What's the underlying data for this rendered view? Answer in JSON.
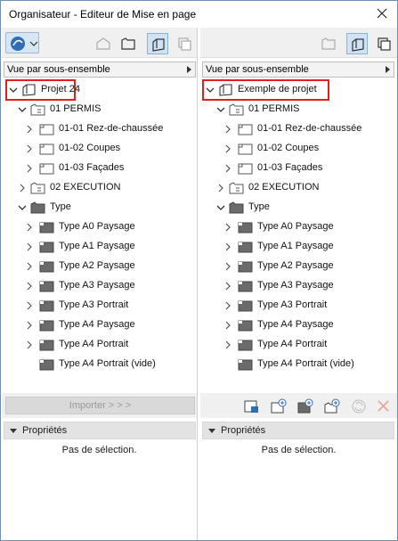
{
  "window": {
    "title": "Organisateur - Editeur de Mise en page"
  },
  "left": {
    "view_select": "Vue par sous-ensemble",
    "root": "Projet 24",
    "items": [
      {
        "label": "01 PERMIS"
      },
      {
        "label": "01-01 Rez-de-chaussée"
      },
      {
        "label": "01-02 Coupes"
      },
      {
        "label": "01-03 Façades"
      },
      {
        "label": "02 EXECUTION"
      },
      {
        "label": "Type"
      },
      {
        "label": "Type A0 Paysage"
      },
      {
        "label": "Type A1 Paysage"
      },
      {
        "label": "Type A2 Paysage"
      },
      {
        "label": "Type A3 Paysage"
      },
      {
        "label": "Type A3 Portrait"
      },
      {
        "label": "Type A4 Paysage"
      },
      {
        "label": "Type A4 Portrait"
      },
      {
        "label": "Type A4 Portrait (vide)"
      }
    ],
    "import_label": "Importer > > >",
    "props_title": "Propriétés",
    "props_text": "Pas de sélection."
  },
  "right": {
    "view_select": "Vue par sous-ensemble",
    "root": "Exemple de projet",
    "items": [
      {
        "label": "01 PERMIS"
      },
      {
        "label": "01-01 Rez-de-chaussée"
      },
      {
        "label": "01-02 Coupes"
      },
      {
        "label": "01-03 Façades"
      },
      {
        "label": "02 EXECUTION"
      },
      {
        "label": "Type"
      },
      {
        "label": "Type A0 Paysage"
      },
      {
        "label": "Type A1 Paysage"
      },
      {
        "label": "Type A2 Paysage"
      },
      {
        "label": "Type A3 Paysage"
      },
      {
        "label": "Type A3 Portrait"
      },
      {
        "label": "Type A4 Paysage"
      },
      {
        "label": "Type A4 Portrait"
      },
      {
        "label": "Type A4 Portrait (vide)"
      }
    ],
    "props_title": "Propriétés",
    "props_text": "Pas de sélection."
  },
  "colors": {
    "highlight_border": "#e0201c",
    "active_tool": "#cfe3f5"
  }
}
